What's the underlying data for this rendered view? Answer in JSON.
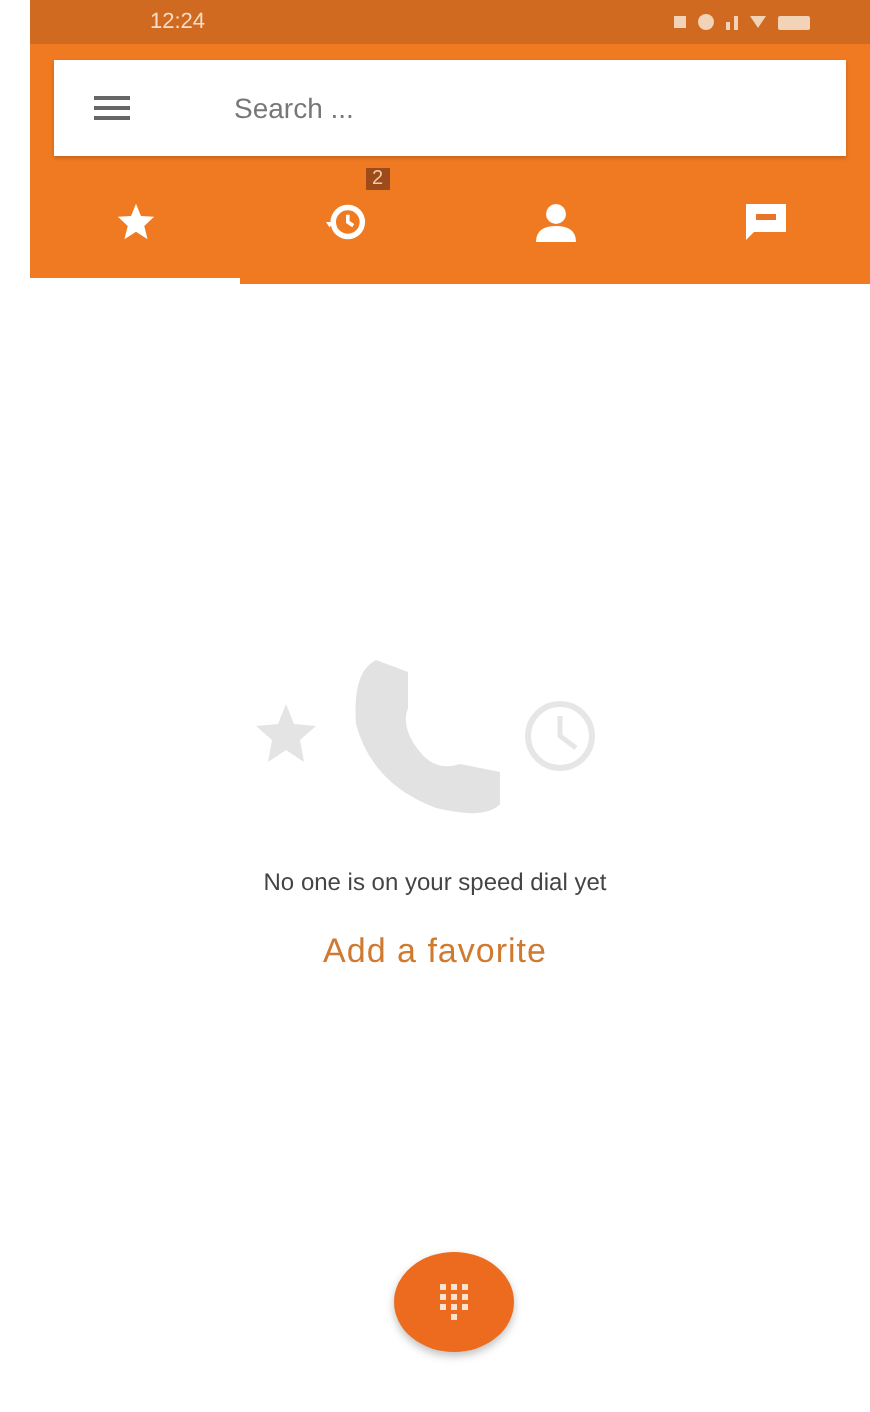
{
  "status_bar": {
    "time": "12:24"
  },
  "search": {
    "placeholder": "Search ..."
  },
  "tabs": [
    {
      "kind": "favorites",
      "selected": true
    },
    {
      "kind": "recents",
      "selected": false,
      "badge": "2"
    },
    {
      "kind": "contacts",
      "selected": false
    },
    {
      "kind": "messages",
      "selected": false
    }
  ],
  "empty_state": {
    "message": "No one is on your speed dial yet",
    "action": "Add a favorite"
  }
}
